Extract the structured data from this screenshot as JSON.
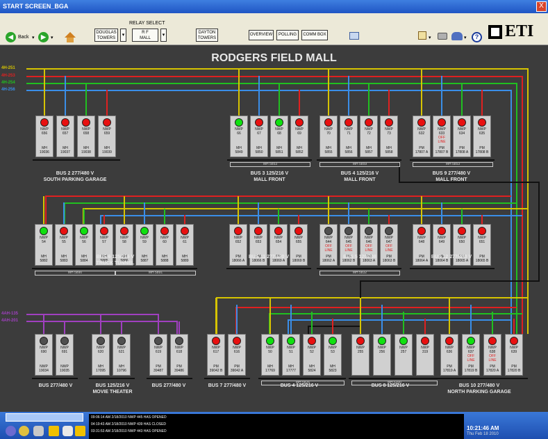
{
  "window": {
    "title": "START SCREEN_BGA",
    "close": "X"
  },
  "toolbar": {
    "relay_select": "RELAY SELECT",
    "back": "Back",
    "relays": [
      "DOUGLAS\nTOWERS",
      "R F\nMALL",
      "DAYTON\nTOWERS"
    ],
    "overview": "OVERVIEW",
    "polling": "POLLING",
    "comm_box": "COMM BOX",
    "logo": "ETI"
  },
  "page_title": "RODGERS FIELD MALL",
  "feeders_top": [
    {
      "label": "4H-251",
      "color": "#d6c400"
    },
    {
      "label": "4H-253",
      "color": "#e02020"
    },
    {
      "label": "4H-254",
      "color": "#20c020"
    },
    {
      "label": "4H-256",
      "color": "#3a8ee8"
    }
  ],
  "feeders_bottom": [
    {
      "label": "4AH-135",
      "color": "#a040c0"
    },
    {
      "label": "4AH-201",
      "color": "#a040c0"
    }
  ],
  "colors": {
    "red": "#e81010",
    "green": "#10e010",
    "gray": "#505050",
    "yellow": "#d6c400",
    "blue": "#3a8ee8",
    "purple": "#a040c0"
  },
  "buses": [
    {
      "label": "BUS 2 277/480 V\nSOUTH PARKING GARAGE",
      "relays": [
        {
          "num": "NWP\n656",
          "state": "red",
          "st": "",
          "mh": "MH\n19036"
        },
        {
          "num": "NWP\n657",
          "state": "red",
          "st": "",
          "mh": "MH\n19037"
        },
        {
          "num": "NWP\n658",
          "state": "red",
          "st": "",
          "mh": "MH\n19038"
        },
        {
          "num": "NWP\n659",
          "state": "red",
          "st": "",
          "mh": "MH\n19039"
        }
      ]
    },
    {
      "label": "BUS 3 125/216 V\nMALL FRONT",
      "sub": "MH 5853",
      "relays": [
        {
          "num": "NWP\n66",
          "state": "green",
          "st": "",
          "mh": "MH\n5849"
        },
        {
          "num": "NWP\n67",
          "state": "red",
          "st": "",
          "mh": "MH\n5850"
        },
        {
          "num": "NWP\n68",
          "state": "green",
          "st": "",
          "mh": "MH\n5851"
        },
        {
          "num": "NWP\n69",
          "state": "red",
          "st": "",
          "mh": "MH\n5852"
        }
      ]
    },
    {
      "label": "BUS 4 125/216 V\nMALL FRONT",
      "sub": "MH 5859",
      "relays": [
        {
          "num": "NWP\n70",
          "state": "red",
          "st": "",
          "mh": "MH\n5855"
        },
        {
          "num": "NWP\n71",
          "state": "red",
          "st": "",
          "mh": "MH\n5856"
        },
        {
          "num": "NWP\n72",
          "state": "red",
          "st": "",
          "mh": "MH\n5857"
        },
        {
          "num": "NWP\n73",
          "state": "red",
          "st": "",
          "mh": "MH\n5858"
        }
      ]
    },
    {
      "label": "BUS 9 277/480 V\nMALL FRONT",
      "sub": "MH 5853",
      "relays": [
        {
          "num": "NWP\n632",
          "state": "red",
          "st": "",
          "mh": "PM\n17807 A"
        },
        {
          "num": "NWP\n633",
          "state": "red",
          "st": "OFF\nLINE",
          "mh": "PM\n17807 B"
        },
        {
          "num": "NWP\n634",
          "state": "red",
          "st": "",
          "mh": "PM\n17808 A"
        },
        {
          "num": "NWP\n635",
          "state": "red",
          "st": "",
          "mh": "PM\n17808 B"
        }
      ]
    },
    {
      "label": "BUS 6 125/216 V\nTRUCK TUNNEL",
      "sub": "MH 5890",
      "sub2": "MH 5891",
      "relays": [
        {
          "num": "NWP\n54",
          "state": "green",
          "st": "",
          "mh": "MH\n5882"
        },
        {
          "num": "NWP\n55",
          "state": "red",
          "st": "",
          "mh": "MH\n5883"
        },
        {
          "num": "NWP\n56",
          "state": "green",
          "st": "",
          "mh": "MH\n5884"
        },
        {
          "num": "NWP\n57",
          "state": "red",
          "st": "",
          "mh": "MH\n5885"
        },
        {
          "num": "NWP\n58",
          "state": "red",
          "st": "",
          "mh": "MH\n5886"
        },
        {
          "num": "NWP\n59",
          "state": "green",
          "st": "",
          "mh": "MH\n5887"
        },
        {
          "num": "NWP\n60",
          "state": "red",
          "st": "",
          "mh": "MH\n5888"
        },
        {
          "num": "NWP\n61",
          "state": "red",
          "st": "",
          "mh": "MH\n5889"
        }
      ]
    },
    {
      "label": "BUS 11 277/480 V",
      "relays": [
        {
          "num": "NWP\n652",
          "state": "red",
          "st": "",
          "mh": "PM\n18066 A"
        },
        {
          "num": "NWP\n653",
          "state": "red",
          "st": "",
          "mh": "PM\n18066 B"
        },
        {
          "num": "NWP\n654",
          "state": "red",
          "st": "",
          "mh": "PM\n18069 A"
        },
        {
          "num": "NWP\n655",
          "state": "red",
          "st": "",
          "mh": "PM\n18069 B"
        }
      ]
    },
    {
      "label": "BUS 5 120/208",
      "sub": "MH 5832",
      "relays": [
        {
          "num": "NWP\n644",
          "state": "gray",
          "st": "OFF\nLINE",
          "mh": "PM\n18062 A"
        },
        {
          "num": "NWP\n645",
          "state": "gray",
          "st": "OFF\nLINE",
          "mh": "PM\n18062 B"
        },
        {
          "num": "NWP\n646",
          "state": "gray",
          "st": "OFF\nLINE",
          "mh": "PM\n18063 A"
        },
        {
          "num": "NWP\n647",
          "state": "gray",
          "st": "OFF\nLINE",
          "mh": "PM\n18063 B"
        }
      ]
    },
    {
      "label": "BUS 12 277/480 V",
      "relays": [
        {
          "num": "NWP\n648",
          "state": "red",
          "st": "",
          "mh": "PM\n18064 A"
        },
        {
          "num": "NWP\n649",
          "state": "red",
          "st": "",
          "mh": "PM\n18064 B"
        },
        {
          "num": "NWP\n650",
          "state": "red",
          "st": "",
          "mh": "PM\n18065 A"
        },
        {
          "num": "NWP\n651",
          "state": "red",
          "st": "",
          "mh": "PM\n18065 B"
        }
      ]
    },
    {
      "label": "BUS 277/480 V",
      "relays": [
        {
          "num": "NWP\n690",
          "state": "gray",
          "st": "",
          "mh": "NWP\n19034"
        },
        {
          "num": "NWP\n691",
          "state": "gray",
          "st": "",
          "mh": "NWP\n19035"
        }
      ]
    },
    {
      "label": "BUS 125/216 V\nMOVIE THEATER",
      "relays": [
        {
          "num": "NWP\n620",
          "state": "gray",
          "st": "",
          "mh": "MH\n17095"
        },
        {
          "num": "NWP\n621",
          "state": "gray",
          "st": "",
          "mh": "MH\n10796"
        }
      ]
    },
    {
      "label": "BUS 277/480 V",
      "relays": [
        {
          "num": "NWP\n619",
          "state": "gray",
          "st": "",
          "mh": "PM\n39487"
        },
        {
          "num": "NWP\n618",
          "state": "gray",
          "st": "",
          "mh": "PM\n39486"
        }
      ]
    },
    {
      "label": "BUS 7 277/480 V",
      "relays": [
        {
          "num": "NWP\n617",
          "state": "red",
          "st": "",
          "mh": "PM\n39042 B"
        },
        {
          "num": "NWP\n616",
          "state": "red",
          "st": "",
          "mh": "PM\n39042 A"
        }
      ]
    },
    {
      "label": "BUS 4 125/216 V",
      "sub": "MH 5826",
      "relays": [
        {
          "num": "NWP\n50",
          "state": "green",
          "st": "",
          "mh": "MH\n17769"
        },
        {
          "num": "NWP\n51",
          "state": "green",
          "st": "",
          "mh": "MH\n17777"
        },
        {
          "num": "NWP\n52",
          "state": "red",
          "st": "",
          "mh": "MH\n5824"
        },
        {
          "num": "NWP\n53",
          "state": "green",
          "st": "",
          "mh": "MH\n5823"
        }
      ]
    },
    {
      "label": "BUS 8 125/216 V",
      "sub": "MH 6300",
      "relays": [
        {
          "num": "NWP\n255",
          "state": "red",
          "st": "",
          "mh": ""
        },
        {
          "num": "NWP\n256",
          "state": "green",
          "st": "",
          "mh": ""
        },
        {
          "num": "NWP\n257",
          "state": "green",
          "st": "",
          "mh": ""
        },
        {
          "num": "NWP\n319",
          "state": "red",
          "st": "",
          "mh": ""
        }
      ]
    },
    {
      "label": "BUS 10 277/480 V\nNORTH PARKING GARAGE",
      "relays": [
        {
          "num": "NWP\n636",
          "state": "red",
          "st": "",
          "mh": "PM\n17819 A"
        },
        {
          "num": "NWP\n637",
          "state": "green",
          "st": "OFF\nLINE",
          "mh": "PM\n17819 B"
        },
        {
          "num": "NWP\n638",
          "state": "red",
          "st": "OFF\nLINE",
          "mh": "PM\n17820 A"
        },
        {
          "num": "NWP\n639",
          "state": "red",
          "st": "",
          "mh": "PM\n17820 B"
        }
      ]
    }
  ],
  "log": [
    {
      "time": "09:06:14 AM",
      "date": "2/18/2010",
      "msg": "NWP 445 HAS OPENED"
    },
    {
      "time": "04:19:43 AM",
      "date": "2/18/2010",
      "msg": "NWP 439 HAS CLOSED"
    },
    {
      "time": "03:31:53 AM",
      "date": "2/18/2010",
      "msg": "NWP 443 HAS OPENED"
    }
  ],
  "clock": "10:21:46 AM",
  "date": "Thu Feb 18 2010"
}
